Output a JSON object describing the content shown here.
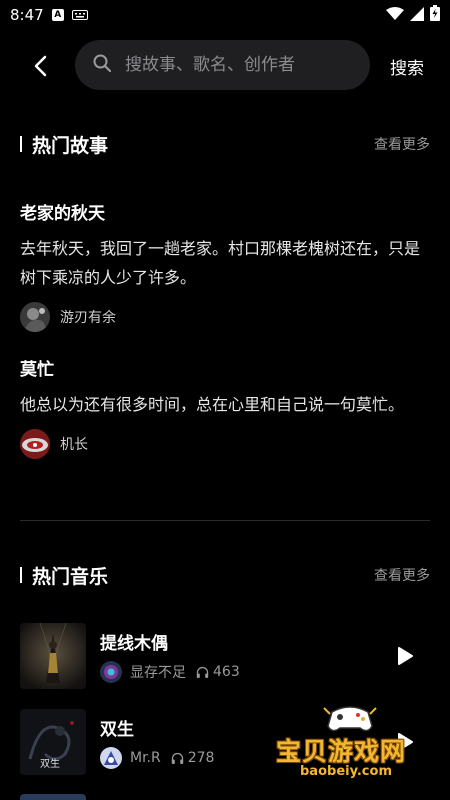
{
  "status_bar": {
    "time": "8:47",
    "a_badge": "A"
  },
  "header": {
    "search_placeholder": "搜故事、歌名、创作者",
    "search_button": "搜索"
  },
  "stories_section": {
    "title": "热门故事",
    "more": "查看更多",
    "items": [
      {
        "title": "老家的秋天",
        "excerpt": "去年秋天，我回了一趟老家。村口那棵老槐树还在，只是树下乘凉的人少了许多。",
        "author": "游刃有余"
      },
      {
        "title": "莫忙",
        "excerpt": "他总以为还有很多时间，总在心里和自己说一句莫忙。",
        "author": "机长"
      }
    ]
  },
  "music_section": {
    "title": "热门音乐",
    "more": "查看更多",
    "items": [
      {
        "title": "提线木偶",
        "artist": "显存不足",
        "plays": "463"
      },
      {
        "title": "双生",
        "artist": "Mr.R",
        "plays": "278",
        "cover_text": "双生"
      }
    ]
  },
  "watermark": {
    "text": "宝贝游戏网",
    "url": "baobeiy.com"
  }
}
